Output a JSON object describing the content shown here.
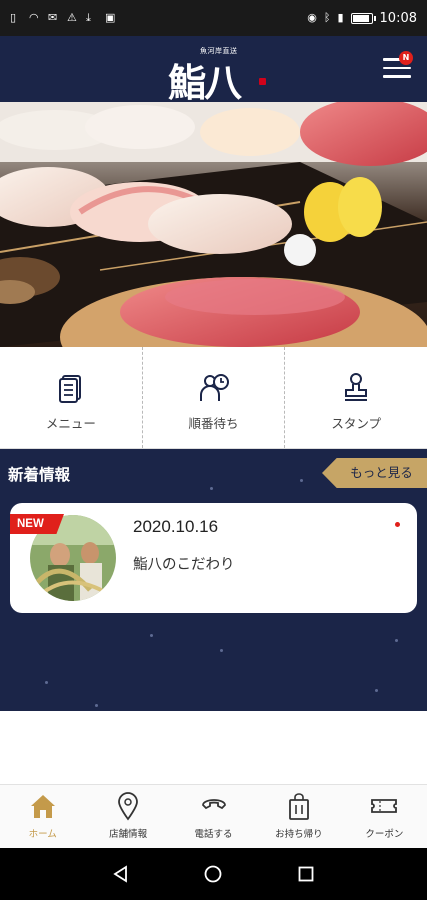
{
  "status_bar": {
    "time": "10:08"
  },
  "header": {
    "logo_subtitle": "魚河岸直送",
    "logo_text": "鮨八",
    "menu_badge": "N"
  },
  "quick_menu": {
    "items": [
      {
        "label": "メニュー",
        "icon": "menu-book-icon"
      },
      {
        "label": "順番待ち",
        "icon": "queue-wait-icon"
      },
      {
        "label": "スタンプ",
        "icon": "stamp-icon"
      }
    ]
  },
  "news": {
    "title": "新着情報",
    "more_label": "もっと見る",
    "items": [
      {
        "tag": "NEW",
        "date": "2020.10.16",
        "text": "鮨八のこだわり",
        "unread": true
      }
    ]
  },
  "tab_bar": {
    "items": [
      {
        "label": "ホーム",
        "icon": "home-icon",
        "active": true
      },
      {
        "label": "店舗情報",
        "icon": "location-pin-icon",
        "active": false
      },
      {
        "label": "電話する",
        "icon": "phone-icon",
        "active": false
      },
      {
        "label": "お持ち帰り",
        "icon": "takeout-bag-icon",
        "active": false
      },
      {
        "label": "クーポン",
        "icon": "coupon-ticket-icon",
        "active": false
      }
    ]
  },
  "colors": {
    "navy": "#1b2548",
    "gold": "#c6a566",
    "accent_red": "#e0201b"
  }
}
